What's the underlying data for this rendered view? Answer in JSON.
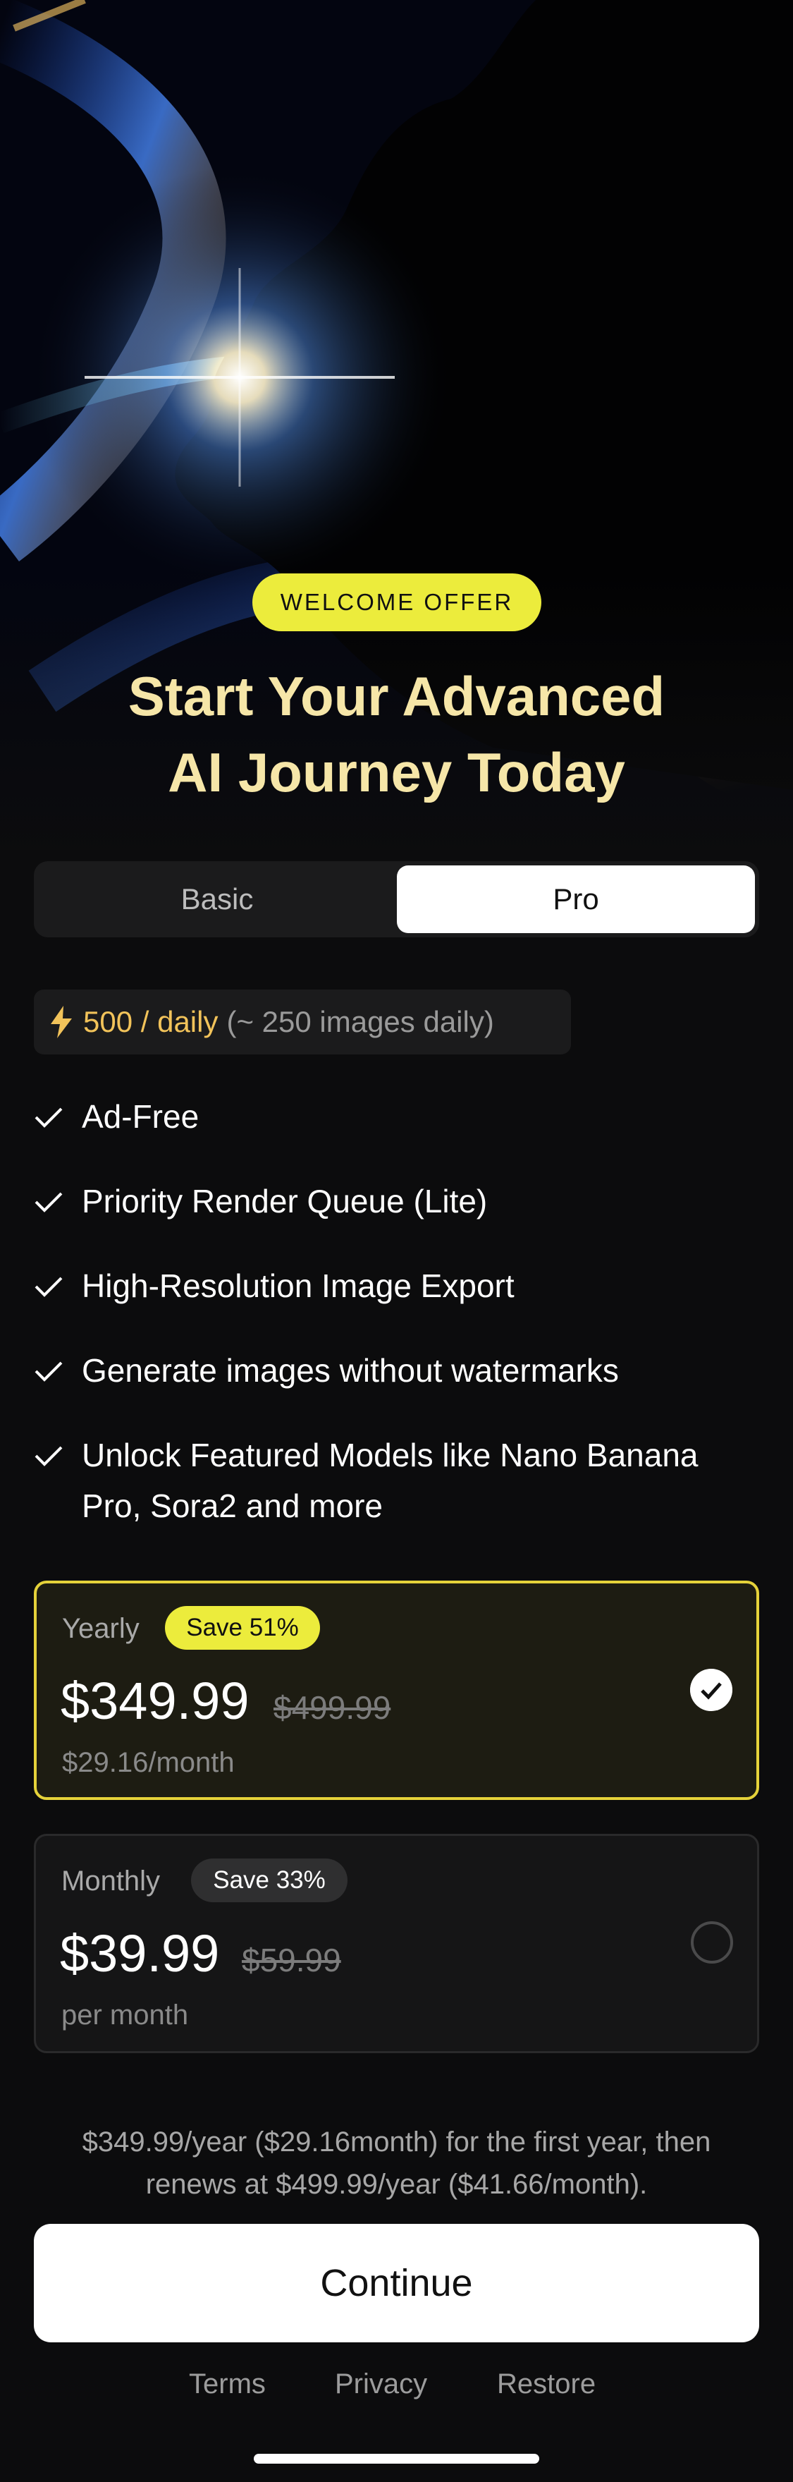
{
  "offer_badge": "WELCOME OFFER",
  "headline": [
    "Start Your Advanced",
    "AI Journey Today"
  ],
  "tabs": [
    {
      "label": "Basic",
      "selected": false
    },
    {
      "label": "Pro",
      "selected": true
    }
  ],
  "quota": {
    "icon": "lightning-bolt-icon",
    "amount": "500 / daily",
    "detail": "(~ 250 images daily)"
  },
  "features": [
    "Ad-Free",
    "Priority Render Queue (Lite)",
    "High-Resolution Image Export",
    "Generate images without watermarks",
    [
      "Unlock Featured Models like Nano Banana",
      "Pro, Sora2 and more"
    ]
  ],
  "plans": [
    {
      "name": "Yearly",
      "save": "Save 51%",
      "price": "$349.99",
      "original": "$499.99",
      "per": "$29.16/month",
      "selected": true
    },
    {
      "name": "Monthly",
      "save": "Save 33%",
      "price": "$39.99",
      "original": "$59.99",
      "per": "per month",
      "selected": false
    }
  ],
  "disclaimer": [
    "$349.99/year ($29.16month) for the first year, then",
    "renews at $499.99/year ($41.66/month)."
  ],
  "cta": "Continue",
  "footer": [
    "Terms",
    "Privacy",
    "Restore"
  ],
  "colors": {
    "accent_yellow": "#ecec3c",
    "headline": "#f6e6a8",
    "quota": "#f2c35a",
    "selected_border": "#e5d23a",
    "background": "#0c0c0d"
  }
}
